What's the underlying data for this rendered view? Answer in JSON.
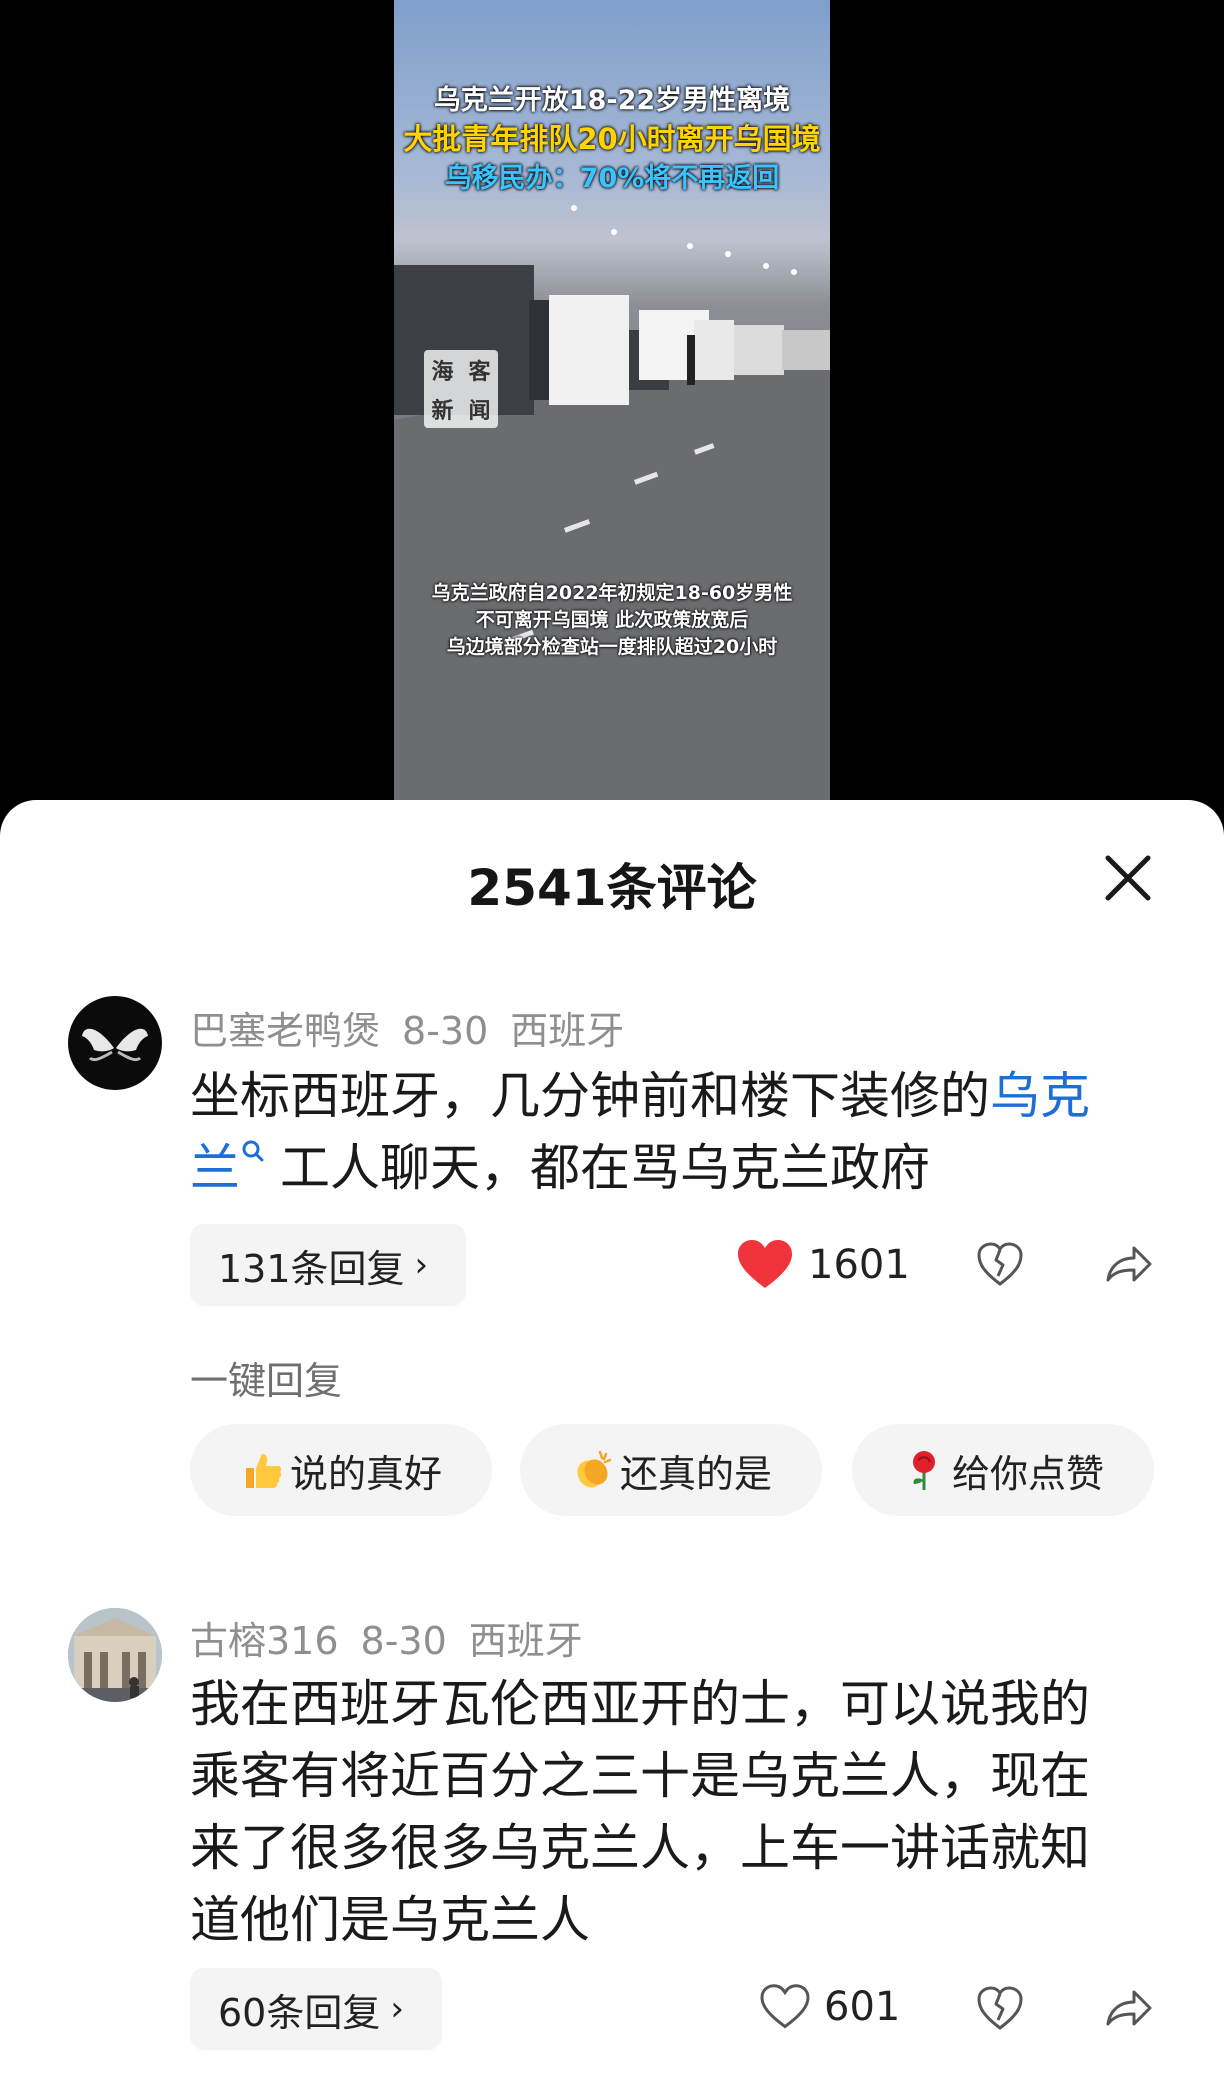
{
  "video": {
    "headline_1": "乌克兰开放18-22岁男性离境",
    "headline_2": "大批青年排队20小时离开乌国境",
    "headline_3": "乌移民办：70%将不再返回",
    "subtitle_1": "乌克兰政府自2022年初规定18-60岁男性",
    "subtitle_2": "不可离开乌国境 此次政策放宽后",
    "subtitle_3": "乌边境部分检查站一度排队超过20小时",
    "watermark": [
      "海",
      "客",
      "新",
      "闻"
    ]
  },
  "sheet": {
    "title": "2541条评论"
  },
  "comments": [
    {
      "user": "巴塞老鸭煲",
      "date": "8-30",
      "location": "西班牙",
      "text_before": "坐标西班牙，几分钟前和楼下装修的",
      "text_link": "乌克兰",
      "text_after": "工人聊天，都在骂乌克兰政府",
      "replies": "131条回复",
      "likes": "1601",
      "liked": true
    },
    {
      "user": "古榕316",
      "date": "8-30",
      "location": "西班牙",
      "text": "我在西班牙瓦伦西亚开的士，可以说我的乘客有将近百分之三十是乌克兰人，现在来了很多很多乌克兰人，上车一讲话就知道他们是乌克兰人",
      "replies": "60条回复",
      "likes": "601",
      "liked": false
    }
  ],
  "quick_reply": {
    "label": "一键回复",
    "chips": [
      "说的真好",
      "还真的是",
      "给你点赞"
    ]
  },
  "colors": {
    "like_red": "#f0343c",
    "link_blue": "#1d6fd6",
    "meta_gray": "#8f8f8f"
  }
}
